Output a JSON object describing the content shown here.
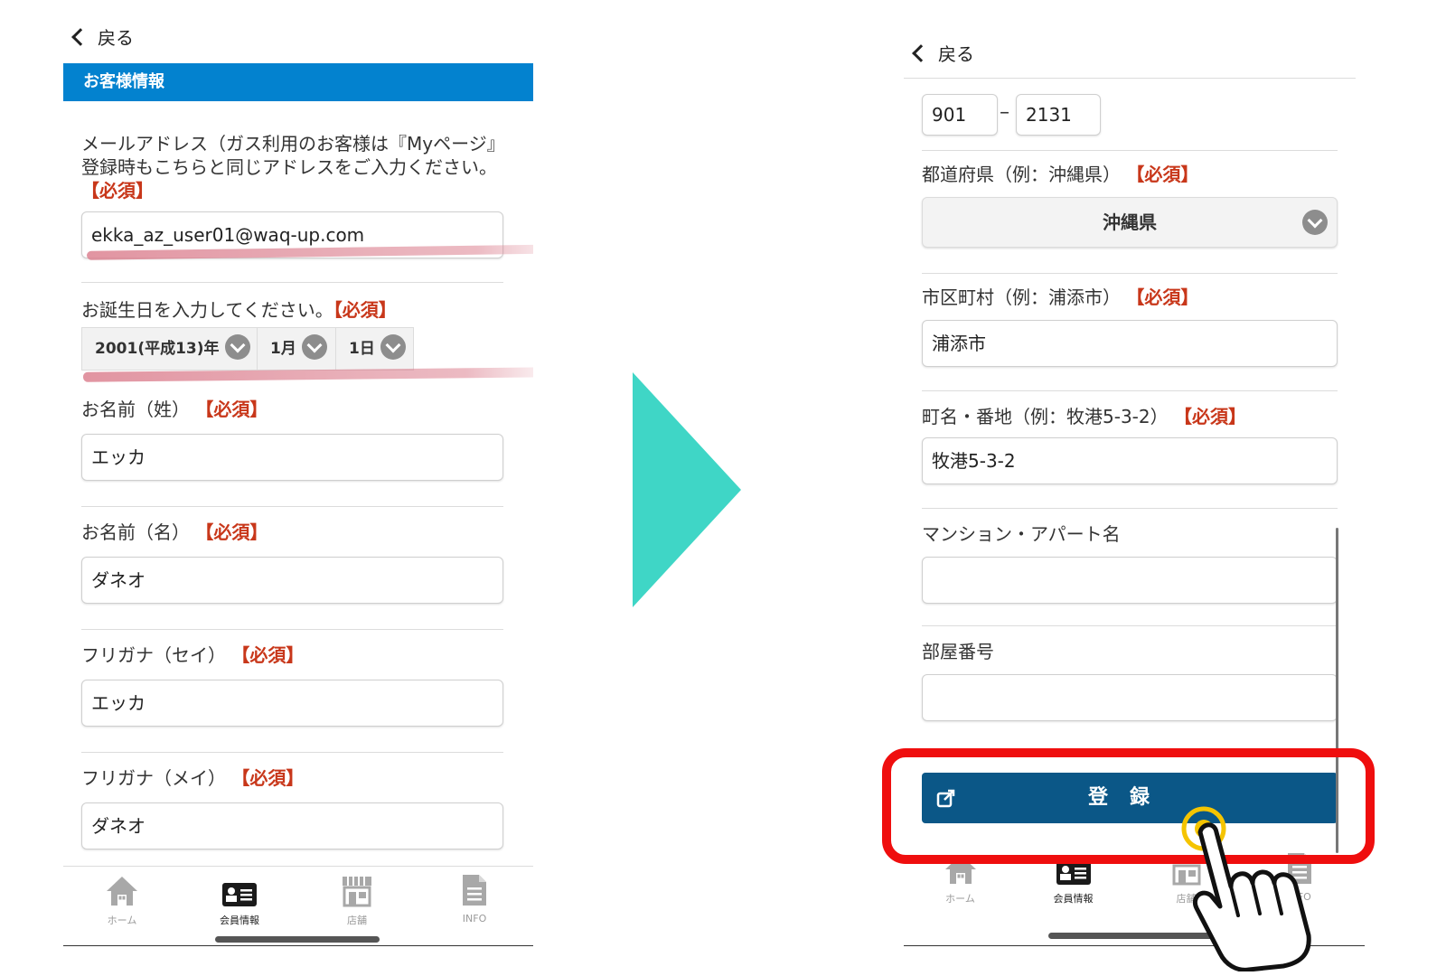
{
  "left": {
    "back_label": "戻る",
    "section_title": "お客様情報",
    "email_label": "メールアドレス（ガス利用のお客様は『Myページ』登録時もこちらと同じアドレスをご入力ください。",
    "email_required": "【必須】",
    "email_value": "ekka_az_user01@waq-up.com",
    "birthday_label": "お誕生日を入力してください。",
    "birthday_required": "【必須】",
    "birth_year": "2001(平成13)年",
    "birth_month": "1月",
    "birth_day": "1日",
    "last_name_label": "お名前（姓）",
    "last_name_required": "【必須】",
    "last_name_value": "エッカ",
    "first_name_label": "お名前（名）",
    "first_name_required": "【必須】",
    "first_name_value": "ダネオ",
    "kana_sei_label": "フリガナ（セイ）",
    "kana_sei_required": "【必須】",
    "kana_sei_value": "エッカ",
    "kana_mei_label": "フリガナ（メイ）",
    "kana_mei_required": "【必須】",
    "kana_mei_value": "ダネオ"
  },
  "right": {
    "back_label": "戻る",
    "zip1_value": "901",
    "zip_separator": "–",
    "zip2_value": "2131",
    "prefecture_label": "都道府県（例：沖縄県）",
    "prefecture_required": "【必須】",
    "prefecture_value": "沖縄県",
    "city_label": "市区町村（例：浦添市）",
    "city_required": "【必須】",
    "city_value": "浦添市",
    "street_label": "町名・番地（例：牧港5-3-2）",
    "street_required": "【必須】",
    "street_value": "牧港5-3-2",
    "building_label": "マンション・アパート名",
    "building_value": "",
    "room_label": "部屋番号",
    "room_value": "",
    "register_button": "登録"
  },
  "tabs": [
    {
      "label": "ホーム",
      "icon": "home-icon"
    },
    {
      "label": "会員情報",
      "icon": "member-card-icon"
    },
    {
      "label": "店舗",
      "icon": "store-icon"
    },
    {
      "label": "INFO",
      "icon": "document-icon"
    }
  ],
  "colors": {
    "section_bar": "#0382cf",
    "required": "#c8371a",
    "register_button": "#0b5787",
    "arrow": "#3fd6c6",
    "highlight": "#ef0e0e"
  }
}
